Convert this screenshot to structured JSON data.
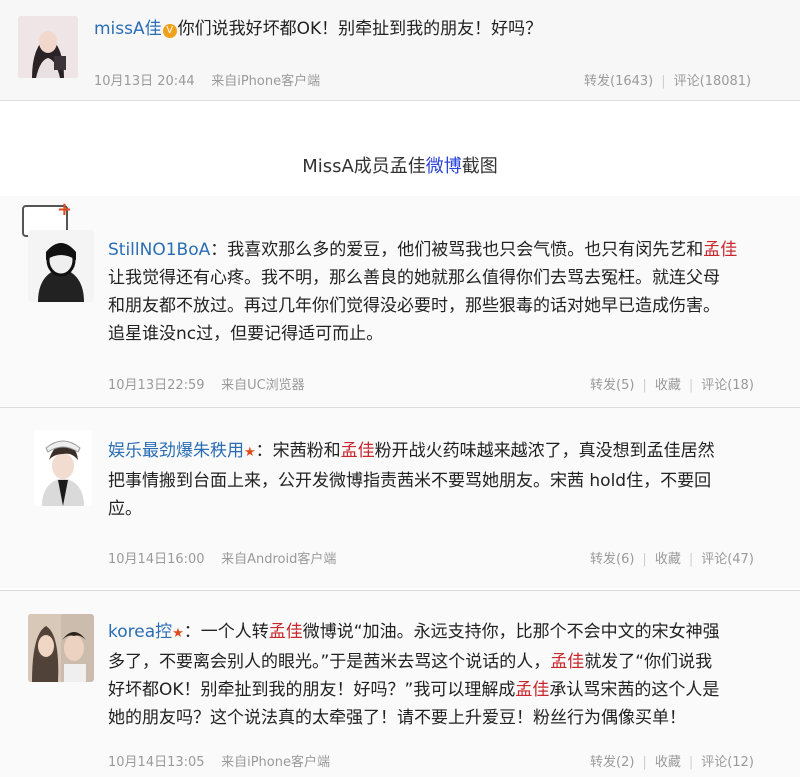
{
  "top_post": {
    "user": "missA佳",
    "verified_icon": "v-badge-icon",
    "text": "你们说我好坏都OK！别牵扯到我的朋友！好吗？",
    "time": "10月13日 20:44",
    "source": "来自iPhone客户端",
    "repost": "转发(1643)",
    "comment": "评论(18081)"
  },
  "caption": {
    "before": "MissA成员孟佳",
    "highlight": "微博",
    "after": "截图"
  },
  "comments": [
    {
      "user": "StillNO1BoA",
      "line1_a": "：我喜欢那么多的爱豆，他们被骂我也只会气愤。也只有闵先艺和",
      "line1_hl": "孟佳",
      "line2": "让我觉得还有心疼。我不明，那么善良的她就那么值得你们去骂去冤枉。就连父母",
      "line3": "和朋友都不放过。再过几年你们觉得没必要时，那些狠毒的话对她早已造成伤害。",
      "line4": "追星谁没nc过，但要记得适可而止。",
      "time": "10月13日22:59",
      "source": "来自UC浏览器",
      "repost": "转发(5)",
      "fav": "收藏",
      "comment": "评论(18)"
    },
    {
      "user": "娱乐最劲爆朱秩用",
      "star_icon": "star-badge-icon",
      "line1_a": "：宋茜粉和",
      "line1_hl": "孟佳",
      "line1_b": "粉开战火药味越来越浓了，真没想到孟佳居然",
      "line2": "把事情搬到台面上来，公开发微博指责茜米不要骂她朋友。宋茜 hold住，不要回",
      "line3": "应。",
      "time": "10月14日16:00",
      "source": "来自Android客户端",
      "repost": "转发(6)",
      "fav": "收藏",
      "comment": "评论(47)"
    },
    {
      "user": "korea控",
      "star_icon": "star-badge-icon",
      "line1_a": "：一个人转",
      "line1_hl": "孟佳",
      "line1_b": "微博说“加油。永远支持你，比那个不会中文的宋女神强",
      "line2_a": "多了，不要离会别人的眼光。”于是茜米去骂这个说话的人，",
      "line2_hl": "孟佳",
      "line2_b": "就发了“你们说我",
      "line3_a": "好坏都OK！别牵扯到我的朋友！好吗？”我可以理解成",
      "line3_hl": "孟佳",
      "line3_b": "承认骂宋茜的这个人是",
      "line4": "她的朋友吗？这个说法真的太牵强了！请不要上升爱豆！粉丝行为偶像买单！",
      "time": "10月14日13:05",
      "source": "来自iPhone客户端",
      "repost": "转发(2)",
      "fav": "收藏",
      "comment": "评论(12)"
    }
  ]
}
